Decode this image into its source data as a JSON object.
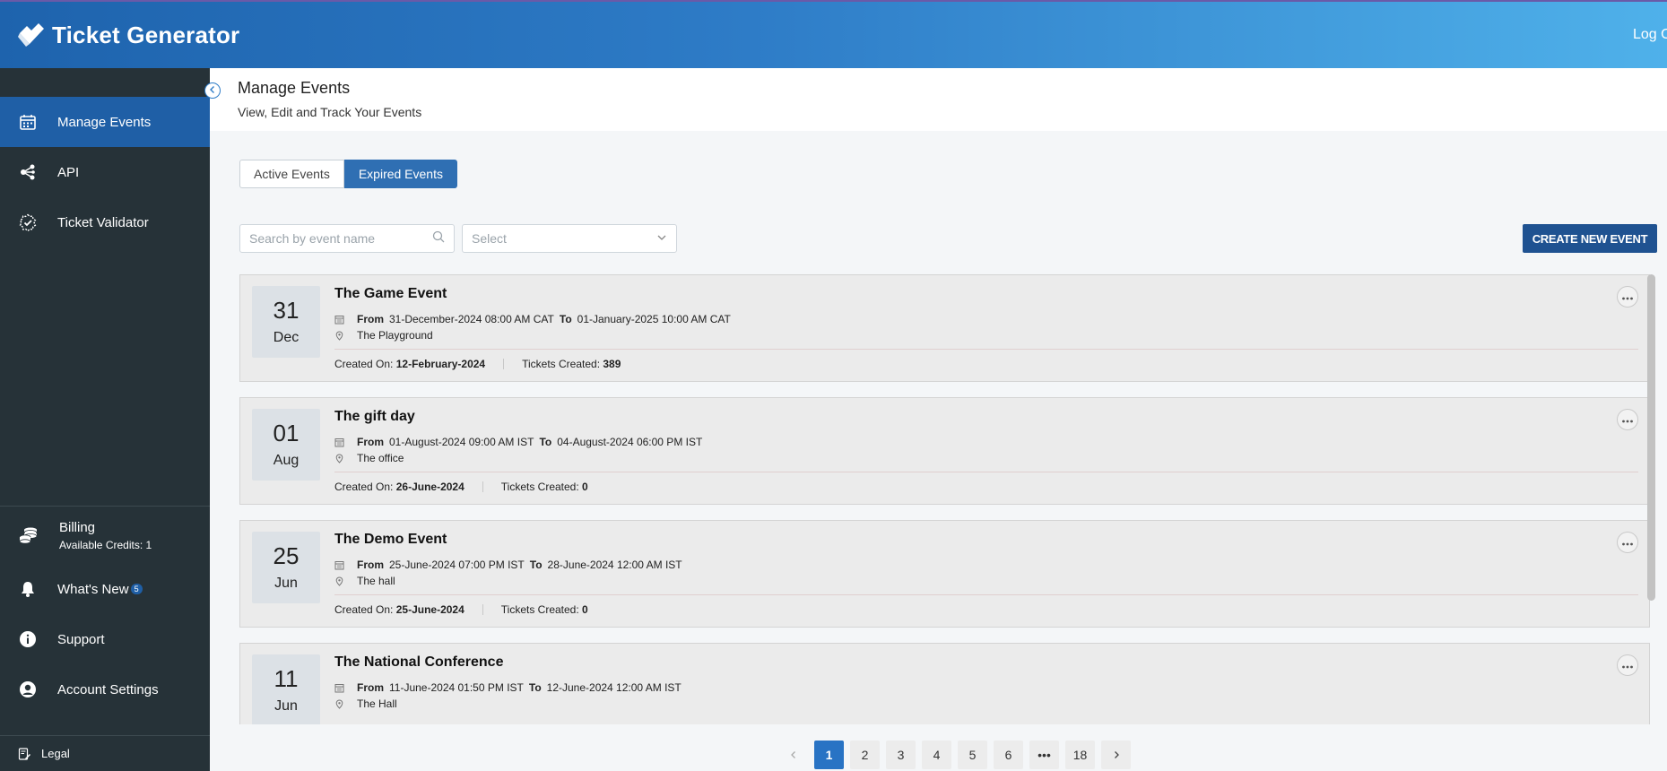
{
  "header": {
    "brand_name": "Ticket Generator",
    "logout_label": "Log Out"
  },
  "sidebar": {
    "items": [
      {
        "label": "Manage Events",
        "icon": "calendar-icon",
        "active": true
      },
      {
        "label": "API",
        "icon": "share-nodes-icon",
        "active": false
      },
      {
        "label": "Ticket Validator",
        "icon": "badge-check-icon",
        "active": false
      }
    ],
    "billing": {
      "title": "Billing",
      "credits_label": "Available Credits: 1",
      "icon": "coins-icon"
    },
    "bottom_items": [
      {
        "label": "What's New",
        "icon": "bell-icon",
        "badge": "5"
      },
      {
        "label": "Support",
        "icon": "info-icon"
      },
      {
        "label": "Account Settings",
        "icon": "user-circle-icon"
      }
    ],
    "legal_label": "Legal"
  },
  "page": {
    "title": "Manage Events",
    "subtitle": "View, Edit and Track Your Events"
  },
  "tabs": [
    {
      "label": "Active Events",
      "active": false
    },
    {
      "label": "Expired Events",
      "active": true
    }
  ],
  "filters": {
    "search_placeholder": "Search by event name",
    "select_placeholder": "Select",
    "create_button": "CREATE NEW EVENT"
  },
  "labels": {
    "from": "From",
    "to": "To",
    "created_on": "Created On:",
    "tickets_created": "Tickets Created:"
  },
  "events": [
    {
      "day": "31",
      "month": "Dec",
      "name": "The Game Event",
      "from": "31-December-2024 08:00 AM CAT",
      "to": "01-January-2025 10:00 AM CAT",
      "location": "The Playground",
      "created_on": "12-February-2024",
      "tickets": "389"
    },
    {
      "day": "01",
      "month": "Aug",
      "name": "The gift day",
      "from": "01-August-2024 09:00 AM IST",
      "to": "04-August-2024 06:00 PM IST",
      "location": "The office",
      "created_on": "26-June-2024",
      "tickets": "0"
    },
    {
      "day": "25",
      "month": "Jun",
      "name": "The Demo Event",
      "from": "25-June-2024 07:00 PM IST",
      "to": "28-June-2024 12:00 AM IST",
      "location": "The hall",
      "created_on": "25-June-2024",
      "tickets": "0"
    },
    {
      "day": "11",
      "month": "Jun",
      "name": "The National Conference",
      "from": "11-June-2024 01:50 PM IST",
      "to": "12-June-2024 12:00 AM IST",
      "location": "The Hall",
      "created_on": "",
      "tickets": ""
    }
  ],
  "pagination": {
    "pages": [
      "1",
      "2",
      "3",
      "4",
      "5",
      "6",
      "•••",
      "18"
    ],
    "current": "1"
  },
  "colors": {
    "accent": "#1f5fa6",
    "sidebar_bg": "#263238",
    "header_start": "#1e63ad",
    "header_end": "#4fb1ea",
    "card_bg": "#ebebeb"
  }
}
